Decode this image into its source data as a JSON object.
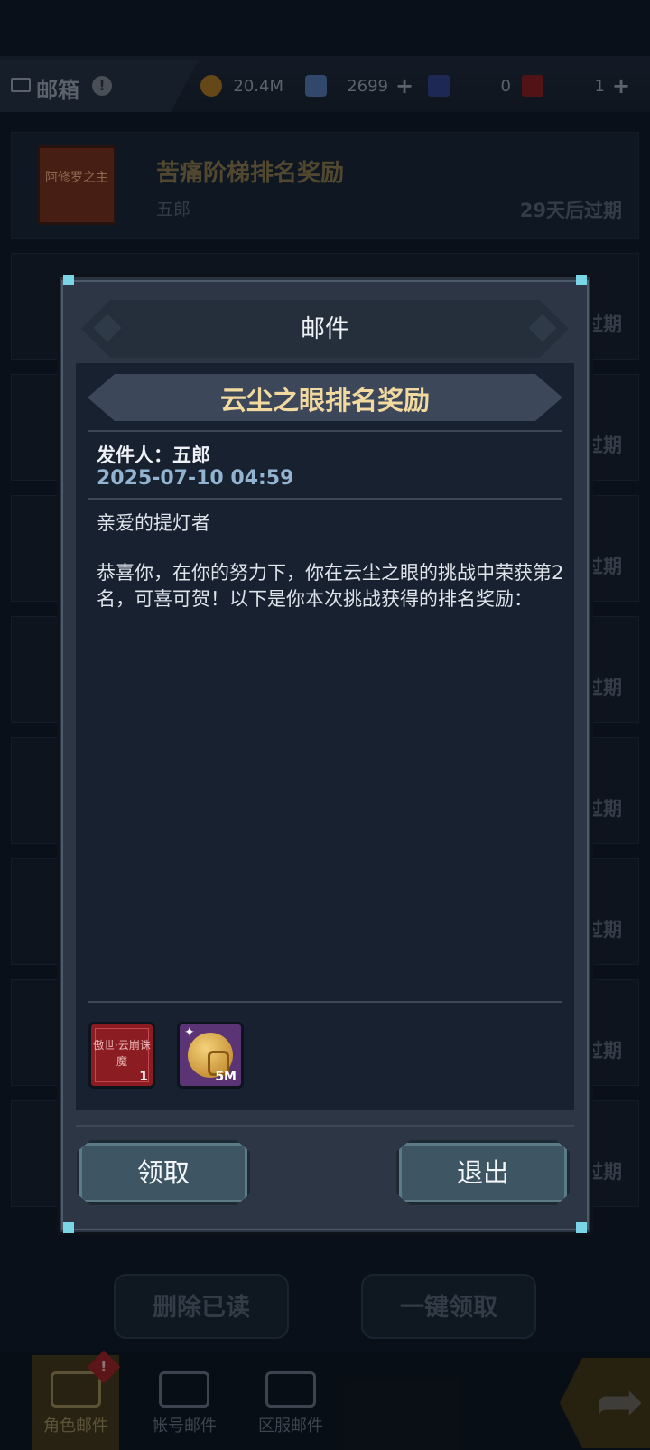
{
  "background": {
    "title": "邮箱",
    "resources": [
      {
        "name": "gold-coin",
        "value": "20.4M",
        "plus": false
      },
      {
        "name": "crystal",
        "value": "2699",
        "plus": true
      },
      {
        "name": "blue-card",
        "value": "0",
        "plus": false
      },
      {
        "name": "red-card",
        "value": "1",
        "plus": true
      }
    ],
    "mail_list": [
      {
        "thumb": "阿修罗之主",
        "subject": "苦痛阶梯排名奖励",
        "sender": "五郎",
        "expire": "29天后过期"
      }
    ],
    "expire_fragment": "过期",
    "buttons": {
      "delete_read": "删除已读",
      "claim_all": "一键领取"
    },
    "nav": [
      {
        "label": "角色邮件",
        "badge": "!"
      },
      {
        "label": "帐号邮件"
      },
      {
        "label": "区服邮件"
      }
    ]
  },
  "modal": {
    "title": "邮件",
    "subject": "云尘之眼排名奖励",
    "sender": "发件人：五郎",
    "date": "2025-07-10 04:59",
    "greeting": "亲爱的提灯者",
    "body": "恭喜你，在你的努力下，你在云尘之眼的挑战中荣获第2名，可喜可贺！以下是你本次挑战获得的排名奖励：",
    "rewards": [
      {
        "name": "傲世·云崩诛魔",
        "qty": "1"
      },
      {
        "name": "gold-coin-bag",
        "qty": "5M"
      }
    ],
    "buttons": {
      "claim": "领取",
      "exit": "退出"
    }
  },
  "colors": {
    "subject": "#f1d9a0",
    "date": "#92b4d0",
    "button": "#3e5664"
  }
}
